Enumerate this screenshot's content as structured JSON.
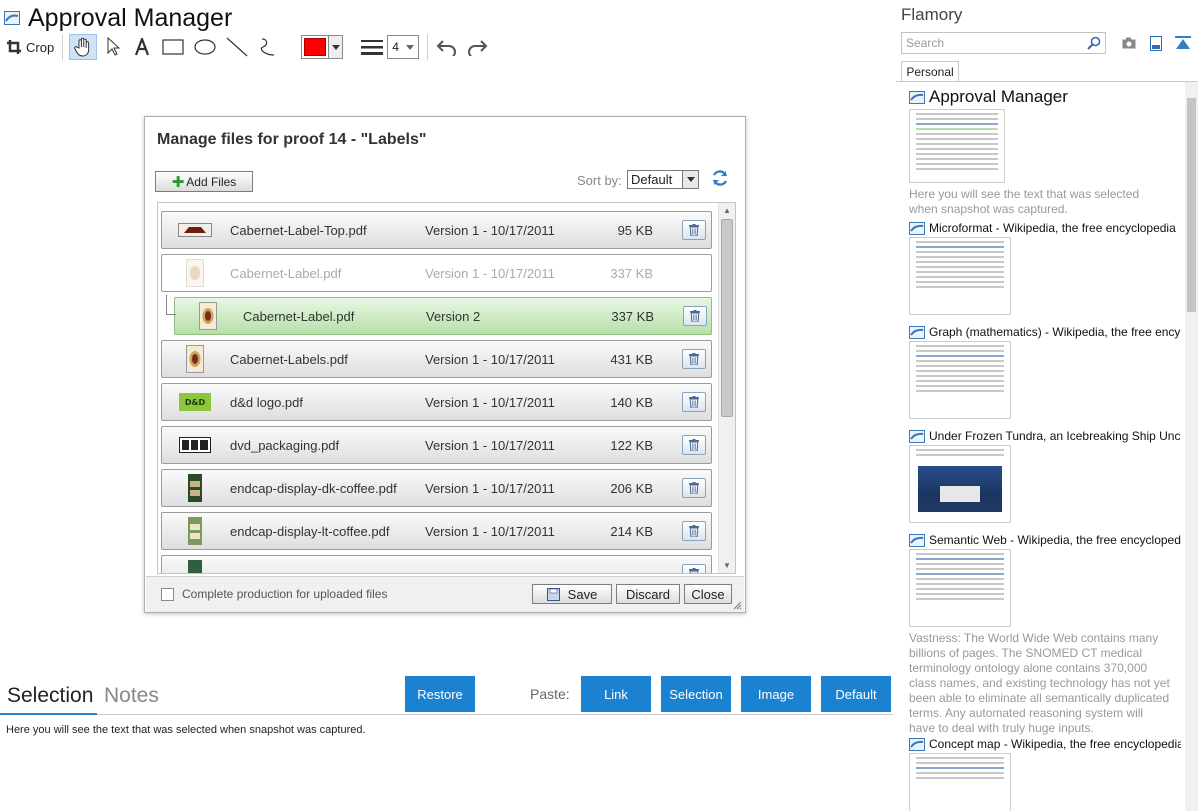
{
  "app": {
    "title": "Approval Manager"
  },
  "toolbar": {
    "crop_label": "Crop",
    "line_width": "4"
  },
  "dialog": {
    "title": "Manage files for proof 14 - \"Labels\"",
    "add_files_label": "Add Files",
    "sort_label": "Sort by:",
    "sort_value": "Default",
    "files": [
      {
        "name": "Cabernet-Label-Top.pdf",
        "version": "Version 1  -  10/17/2011",
        "size": "95 KB",
        "state": "normal"
      },
      {
        "name": "Cabernet-Label.pdf",
        "version": "Version 1  -  10/17/2011",
        "size": "337 KB",
        "state": "muted"
      },
      {
        "name": "Cabernet-Label.pdf",
        "version": "Version 2",
        "size": "337 KB",
        "state": "selected"
      },
      {
        "name": "Cabernet-Labels.pdf",
        "version": "Version 1  -  10/17/2011",
        "size": "431 KB",
        "state": "normal"
      },
      {
        "name": "d&d logo.pdf",
        "version": "Version 1  -  10/17/2011",
        "size": "140 KB",
        "state": "normal"
      },
      {
        "name": "dvd_packaging.pdf",
        "version": "Version 1  -  10/17/2011",
        "size": "122 KB",
        "state": "normal"
      },
      {
        "name": "endcap-display-dk-coffee.pdf",
        "version": "Version 1  -  10/17/2011",
        "size": "206 KB",
        "state": "normal"
      },
      {
        "name": "endcap-display-lt-coffee.pdf",
        "version": "Version 1  -  10/17/2011",
        "size": "214 KB",
        "state": "normal"
      },
      {
        "name": "",
        "version": "",
        "size": "",
        "state": "normal"
      }
    ],
    "complete_label": "Complete production for uploaded files",
    "save_label": "Save",
    "discard_label": "Discard",
    "close_label": "Close"
  },
  "bottom": {
    "tab_selection": "Selection",
    "tab_notes": "Notes",
    "restore_label": "Restore",
    "paste_label": "Paste:",
    "link_label": "Link",
    "selection_label": "Selection",
    "image_label": "Image",
    "default_label": "Default",
    "selection_text": "Here you will see the text that was selected when snapshot was captured."
  },
  "sidebar": {
    "title": "Flamory",
    "search_placeholder": "Search",
    "tab_personal": "Personal",
    "entries": [
      {
        "title": "Approval Manager",
        "desc": "Here you will see the text that was selected when snapshot was captured."
      },
      {
        "title": "Microformat - Wikipedia, the free encyclopedia",
        "desc": ""
      },
      {
        "title": "Graph (mathematics) - Wikipedia, the free ency",
        "desc": ""
      },
      {
        "title": "Under Frozen Tundra, an Icebreaking Ship Unco",
        "desc": ""
      },
      {
        "title": "Semantic Web - Wikipedia, the free encycloped",
        "desc": "Vastness: The World Wide Web contains many billions of pages. The SNOMED CT medical terminology ontology alone contains 370,000 class names, and existing technology has not yet been able to eliminate all semantically duplicated terms. Any automated reasoning system will have to deal with truly huge inputs."
      },
      {
        "title": "Concept map - Wikipedia, the free encyclopedia",
        "desc": ""
      }
    ]
  },
  "colors": {
    "accent": "#1a82d1",
    "selected_row": "#b6e0aa",
    "stroke_color": "#ff0000"
  }
}
